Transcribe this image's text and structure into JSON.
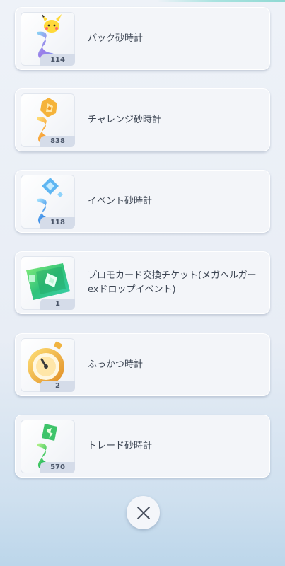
{
  "items": [
    {
      "name": "パック砂時計",
      "count": "114",
      "icon": "hourglass-pokemon-icon",
      "color": "#7f7ee8"
    },
    {
      "name": "チャレンジ砂時計",
      "count": "838",
      "icon": "hourglass-challenge-icon",
      "color": "#f5a340"
    },
    {
      "name": "イベント砂時計",
      "count": "118",
      "icon": "hourglass-event-icon",
      "color": "#4aa6e8"
    },
    {
      "name": "プロモカード交換チケット(メガヘルガーexドロップイベント)",
      "count": "1",
      "icon": "promo-ticket-icon",
      "color": "#3fcf7a"
    },
    {
      "name": "ふっかつ時計",
      "count": "2",
      "icon": "revive-stopwatch-icon",
      "color": "#e9a62c"
    },
    {
      "name": "トレード砂時計",
      "count": "570",
      "icon": "hourglass-trade-icon",
      "color": "#3ec46a"
    }
  ],
  "close": {
    "icon": "close-icon"
  }
}
